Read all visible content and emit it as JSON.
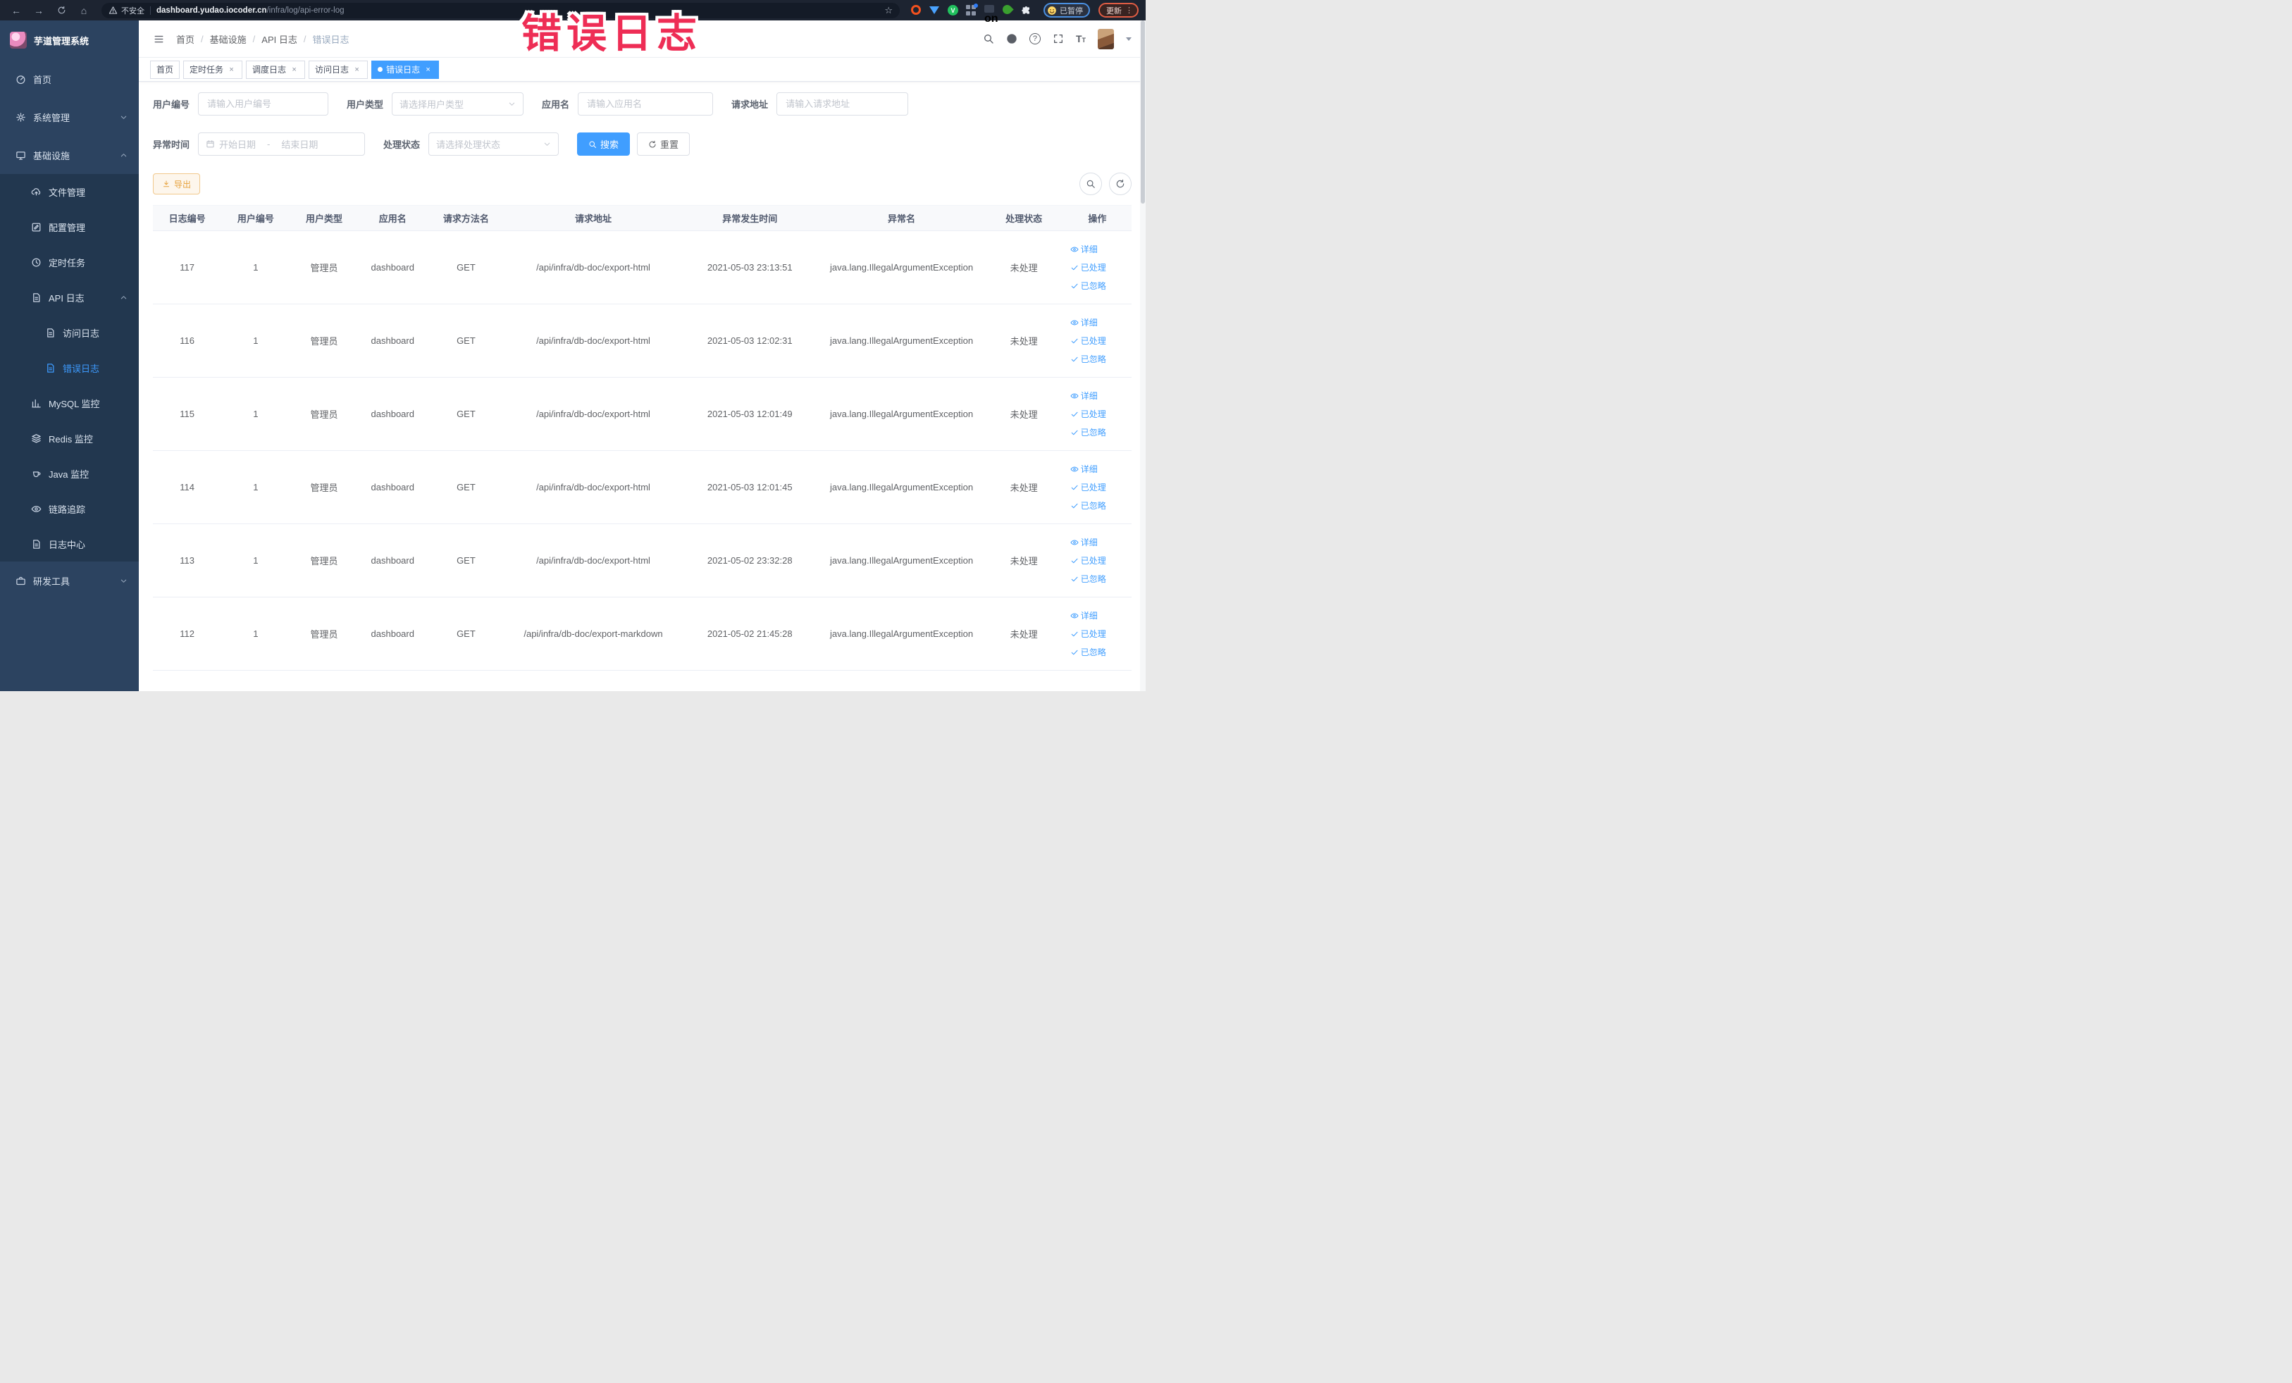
{
  "browser": {
    "security_label": "不安全",
    "url_domain": "dashboard.yudao.iocoder.cn",
    "url_path": "/infra/log/api-error-log",
    "profile_chip_label": "已暂停",
    "update_button_label": "更新"
  },
  "overlay": {
    "text": "错误日志"
  },
  "sidebar": {
    "title": "芋道管理系统",
    "items": [
      {
        "label": "首页"
      },
      {
        "label": "系统管理"
      },
      {
        "label": "基础设施",
        "children": [
          {
            "label": "文件管理"
          },
          {
            "label": "配置管理"
          },
          {
            "label": "定时任务"
          },
          {
            "label": "API 日志",
            "children": [
              {
                "label": "访问日志"
              },
              {
                "label": "错误日志",
                "active": true
              }
            ]
          },
          {
            "label": "MySQL 监控"
          },
          {
            "label": "Redis 监控"
          },
          {
            "label": "Java 监控"
          },
          {
            "label": "链路追踪"
          },
          {
            "label": "日志中心"
          }
        ]
      },
      {
        "label": "研发工具"
      }
    ]
  },
  "header": {
    "breadcrumb": [
      "首页",
      "基础设施",
      "API 日志",
      "错误日志"
    ]
  },
  "tabs": [
    {
      "label": "首页"
    },
    {
      "label": "定时任务",
      "closable": true
    },
    {
      "label": "调度日志",
      "closable": true
    },
    {
      "label": "访问日志",
      "closable": true
    },
    {
      "label": "错误日志",
      "closable": true,
      "active": true
    }
  ],
  "filters": {
    "user_id": {
      "label": "用户编号",
      "placeholder": "请输入用户编号"
    },
    "user_type": {
      "label": "用户类型",
      "placeholder": "请选择用户类型"
    },
    "app_name": {
      "label": "应用名",
      "placeholder": "请输入应用名"
    },
    "request_url": {
      "label": "请求地址",
      "placeholder": "请输入请求地址"
    },
    "exception_time": {
      "label": "异常时间",
      "start_placeholder": "开始日期",
      "separator": "-",
      "end_placeholder": "结束日期"
    },
    "process_status": {
      "label": "处理状态",
      "placeholder": "请选择处理状态"
    },
    "search_label": "搜索",
    "reset_label": "重置"
  },
  "toolbar": {
    "export_label": "导出"
  },
  "table": {
    "columns": [
      "日志编号",
      "用户编号",
      "用户类型",
      "应用名",
      "请求方法名",
      "请求地址",
      "异常发生时间",
      "异常名",
      "处理状态",
      "操作"
    ],
    "row_actions": {
      "detail": "详细",
      "processed": "已处理",
      "ignored": "已忽略"
    },
    "rows": [
      {
        "id": "117",
        "user_id": "1",
        "user_type": "管理员",
        "app": "dashboard",
        "method": "GET",
        "url": "/api/infra/db-doc/export-html",
        "time": "2021-05-03 23:13:51",
        "exception": "java.lang.IllegalArgumentException",
        "status": "未处理"
      },
      {
        "id": "116",
        "user_id": "1",
        "user_type": "管理员",
        "app": "dashboard",
        "method": "GET",
        "url": "/api/infra/db-doc/export-html",
        "time": "2021-05-03 12:02:31",
        "exception": "java.lang.IllegalArgumentException",
        "status": "未处理"
      },
      {
        "id": "115",
        "user_id": "1",
        "user_type": "管理员",
        "app": "dashboard",
        "method": "GET",
        "url": "/api/infra/db-doc/export-html",
        "time": "2021-05-03 12:01:49",
        "exception": "java.lang.IllegalArgumentException",
        "status": "未处理"
      },
      {
        "id": "114",
        "user_id": "1",
        "user_type": "管理员",
        "app": "dashboard",
        "method": "GET",
        "url": "/api/infra/db-doc/export-html",
        "time": "2021-05-03 12:01:45",
        "exception": "java.lang.IllegalArgumentException",
        "status": "未处理"
      },
      {
        "id": "113",
        "user_id": "1",
        "user_type": "管理员",
        "app": "dashboard",
        "method": "GET",
        "url": "/api/infra/db-doc/export-html",
        "time": "2021-05-02 23:32:28",
        "exception": "java.lang.IllegalArgumentException",
        "status": "未处理"
      },
      {
        "id": "112",
        "user_id": "1",
        "user_type": "管理员",
        "app": "dashboard",
        "method": "GET",
        "url": "/api/infra/db-doc/export-markdown",
        "time": "2021-05-02 21:45:28",
        "exception": "java.lang.IllegalArgumentException",
        "status": "未处理"
      }
    ]
  }
}
